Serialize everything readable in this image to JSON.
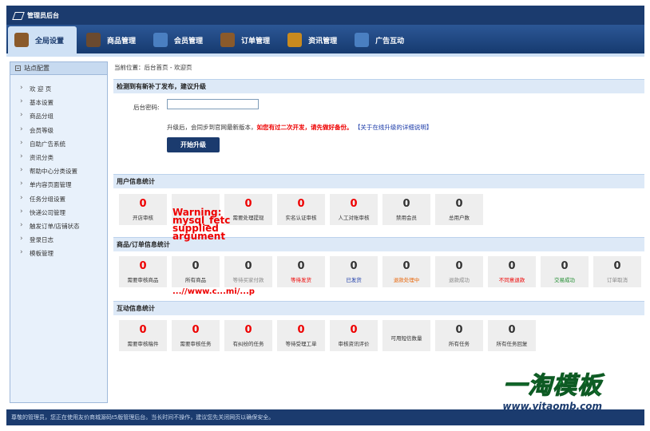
{
  "app": {
    "title": "管理员后台"
  },
  "nav": {
    "tabs": [
      {
        "label": "全局设置",
        "icon": "settings-icon",
        "color": "#8a5a2b"
      },
      {
        "label": "商品管理",
        "icon": "grid-icon",
        "color": "#6b4a2f"
      },
      {
        "label": "会员管理",
        "icon": "user-card-icon",
        "color": "#4a7fc1"
      },
      {
        "label": "订单管理",
        "icon": "book-icon",
        "color": "#8a5a2b"
      },
      {
        "label": "资讯管理",
        "icon": "bag-icon",
        "color": "#c98a1e"
      },
      {
        "label": "广告互动",
        "icon": "window-icon",
        "color": "#4a7fc1"
      }
    ]
  },
  "sidebar": {
    "header": "站点配置",
    "items": [
      "欢 迎 页",
      "基本设置",
      "商品分组",
      "会员等级",
      "自助广告系统",
      "资讯分类",
      "帮助中心分类设置",
      "单内容页面管理",
      "任务分组设置",
      "快递公司管理",
      "触发订单/店铺状态",
      "登录日志",
      "模板管理"
    ]
  },
  "main": {
    "breadcrumb": "当前位置：后台首页 - 欢迎页",
    "upgrade": {
      "title": "检测到有新补丁发布，建议升级",
      "password_label": "后台密码:",
      "note_prefix": "升级后，会同步到官网最新版本，",
      "note_warning": "如您有过二次开发，请先做好备份。",
      "note_link": "【关于在线升级的详细说明】",
      "button": "开始升级"
    },
    "user_stats": {
      "title": "用户信息统计",
      "items": [
        {
          "value": "0",
          "label": "开店审核",
          "color": "#e00"
        },
        {
          "value": "",
          "label": "",
          "color": "#e00"
        },
        {
          "value": "0",
          "label": "需要处理提现",
          "color": "#e00"
        },
        {
          "value": "0",
          "label": "实名认证审核",
          "color": "#e00"
        },
        {
          "value": "0",
          "label": "人工对账审核",
          "color": "#e00"
        },
        {
          "value": "0",
          "label": "禁用会员",
          "color": "#333"
        },
        {
          "value": "0",
          "label": "总用户数",
          "color": "#333"
        }
      ]
    },
    "goods_stats": {
      "title": "商品/订单信息统计",
      "items": [
        {
          "value": "0",
          "label": "需要审核商品",
          "color": "#e00",
          "label_color": "#333"
        },
        {
          "value": "0",
          "label": "所有商品",
          "color": "#333",
          "label_color": "#333"
        },
        {
          "value": "0",
          "label": "等待买家付款",
          "color": "#333",
          "label_color": "#888"
        },
        {
          "value": "0",
          "label": "等待发货",
          "color": "#333",
          "label_color": "#e00"
        },
        {
          "value": "0",
          "label": "已发货",
          "color": "#333",
          "label_color": "#1a3aa8"
        },
        {
          "value": "0",
          "label": "退款处理中",
          "color": "#333",
          "label_color": "#e86a10"
        },
        {
          "value": "0",
          "label": "退款成功",
          "color": "#333",
          "label_color": "#888"
        },
        {
          "value": "0",
          "label": "不同意退款",
          "color": "#333",
          "label_color": "#e00"
        },
        {
          "value": "0",
          "label": "交易成功",
          "color": "#333",
          "label_color": "#1b8a2b"
        },
        {
          "value": "0",
          "label": "订单取消",
          "color": "#333",
          "label_color": "#888"
        }
      ]
    },
    "interact_stats": {
      "title": "互动信息统计",
      "items": [
        {
          "value": "0",
          "label": "需要审核稿件",
          "color": "#e00"
        },
        {
          "value": "0",
          "label": "需要审核任务",
          "color": "#e00"
        },
        {
          "value": "0",
          "label": "有纠纷的任务",
          "color": "#e00"
        },
        {
          "value": "0",
          "label": "等待受理工单",
          "color": "#e00"
        },
        {
          "value": "0",
          "label": "审核资讯评价",
          "color": "#e00"
        },
        {
          "value": "",
          "label": "可用短信数量",
          "color": "#333"
        },
        {
          "value": "0",
          "label": "所有任务",
          "color": "#333"
        },
        {
          "value": "0",
          "label": "所有任务回复",
          "color": "#333"
        }
      ]
    },
    "warning_text": "Warning:\nmysql_fetc\nsupplied\nargument",
    "warning_tail": "...//www.c...mi/...p"
  },
  "watermark": {
    "brand": "一淘模板",
    "url": "www.yitaomb.com"
  },
  "footer": {
    "text": "尊敬的管理员，您正在使用友价商城源码t5版管理后台。当长时间不操作，建议您先关闭网页以确保安全。"
  }
}
